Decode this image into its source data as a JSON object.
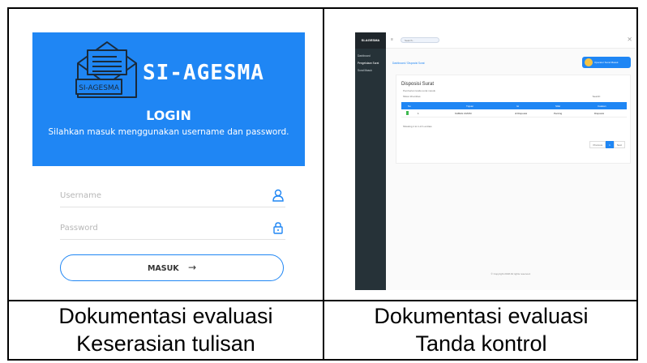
{
  "captions": {
    "left": [
      "Dokumentasi evaluasi",
      "Keserasian tulisan"
    ],
    "right": [
      "Dokumentasi evaluasi",
      "Tanda kontrol"
    ]
  },
  "login": {
    "logo_text": "SI-AGESMA",
    "brand": "SI-AGESMA",
    "title": "LOGIN",
    "subtitle": "Silahkan masuk menggunakan username dan password.",
    "username_placeholder": "Username",
    "password_placeholder": "Password",
    "submit_label": "MASUK",
    "submit_arrow": "→",
    "colors": {
      "header": "#1f86f4",
      "accent": "#1f86f4"
    },
    "icons": {
      "username": "user-icon",
      "password": "lock-icon",
      "submit": "arrow-right-icon"
    }
  },
  "dashboard": {
    "sidebar_brand": "SI-AGESMA",
    "sidebar_items": [
      "Dashboard",
      "Pengelolaan Surat",
      "Surat Masuk"
    ],
    "search_placeholder": "Search...",
    "breadcrumb": "Dashboard / Disposisi Surat",
    "user_name": "Operator Surat Masuk",
    "card_title": "Disposisi Surat",
    "card_subtitle": "Pemberian tanda surat masuk",
    "show_entries": "Show 10 entries",
    "search_label": "Search:",
    "columns": [
      "No",
      "Tujuan",
      "Isi",
      "Sifat",
      "Catatan"
    ],
    "rows": [
      {
        "no": "1",
        "tujuan": "KABAG UMUM",
        "isi": "di Disposisi",
        "sifat": "Penting",
        "catatan": "Disposisi"
      }
    ],
    "info": "Showing 1 to 1 of 1 entries",
    "pager": [
      "Previous",
      "1",
      "Next"
    ],
    "footer": "© Copyright 2018 All rights reserved."
  }
}
